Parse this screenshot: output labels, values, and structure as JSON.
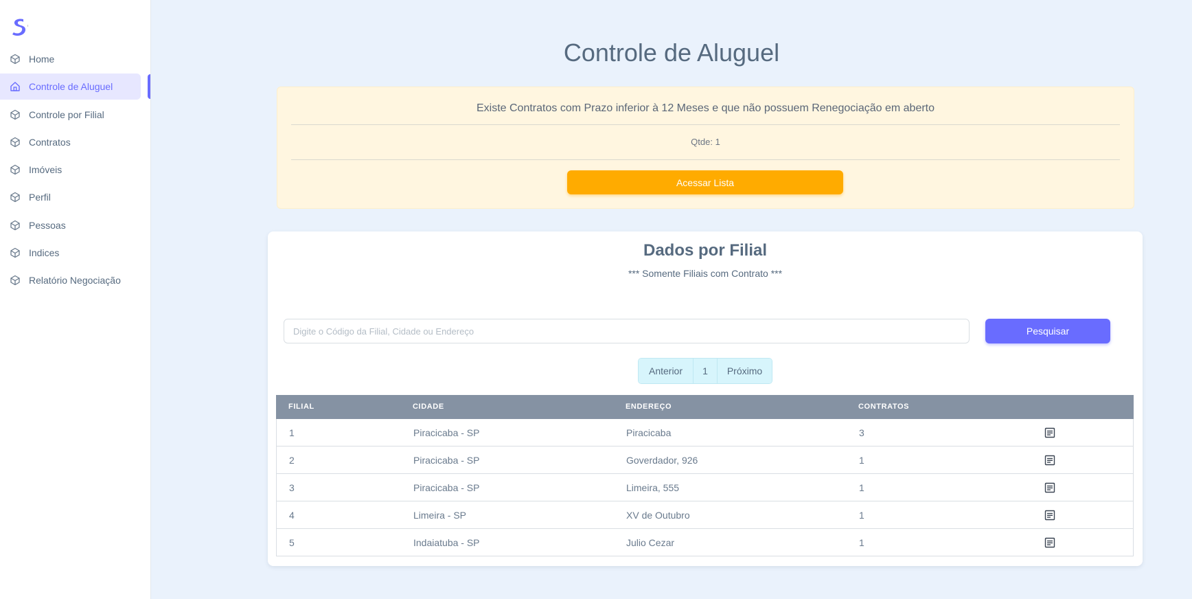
{
  "sidebar": {
    "items": [
      {
        "label": "Home",
        "icon": "cube-icon"
      },
      {
        "label": "Controle de Aluguel",
        "icon": "house-icon",
        "active": true
      },
      {
        "label": "Controle por Filial",
        "icon": "cube-icon"
      },
      {
        "label": "Contratos",
        "icon": "cube-icon"
      },
      {
        "label": "Imóveis",
        "icon": "cube-icon"
      },
      {
        "label": "Perfil",
        "icon": "cube-icon"
      },
      {
        "label": "Pessoas",
        "icon": "cube-icon"
      },
      {
        "label": "Indices",
        "icon": "cube-icon"
      },
      {
        "label": "Relatório Negociação",
        "icon": "cube-icon"
      }
    ]
  },
  "page": {
    "title": "Controle de Aluguel"
  },
  "alert": {
    "message": "Existe Contratos com Prazo inferior à 12 Meses e que não possuem Renegociação em aberto",
    "qtde": "Qtde: 1",
    "button": "Acessar Lista"
  },
  "card": {
    "title": "Dados por Filial",
    "subtitle": "*** Somente Filiais com Contrato ***",
    "search_placeholder": "Digite o Código da Filial, Cidade ou Endereço",
    "search_value": "",
    "search_button": "Pesquisar",
    "pager": {
      "prev": "Anterior",
      "page": "1",
      "next": "Próximo"
    },
    "table": {
      "headers": [
        "FILIAL",
        "CIDADE",
        "ENDEREÇO",
        "CONTRATOS"
      ],
      "rows": [
        [
          "1",
          "Piracicaba - SP",
          "Piracicaba",
          "3"
        ],
        [
          "2",
          "Piracicaba - SP",
          "Goverdador, 926",
          "1"
        ],
        [
          "3",
          "Piracicaba - SP",
          "Limeira, 555",
          "1"
        ],
        [
          "4",
          "Limeira - SP",
          "XV de Outubro",
          "1"
        ],
        [
          "5",
          "Indaiatuba - SP",
          "Julio Cezar",
          "1"
        ]
      ],
      "row_action_icon": "document-icon"
    }
  },
  "colors": {
    "primary": "#696cff",
    "warning": "#ffab00",
    "background": "#eaf2fc",
    "table_header": "#8592a3"
  }
}
